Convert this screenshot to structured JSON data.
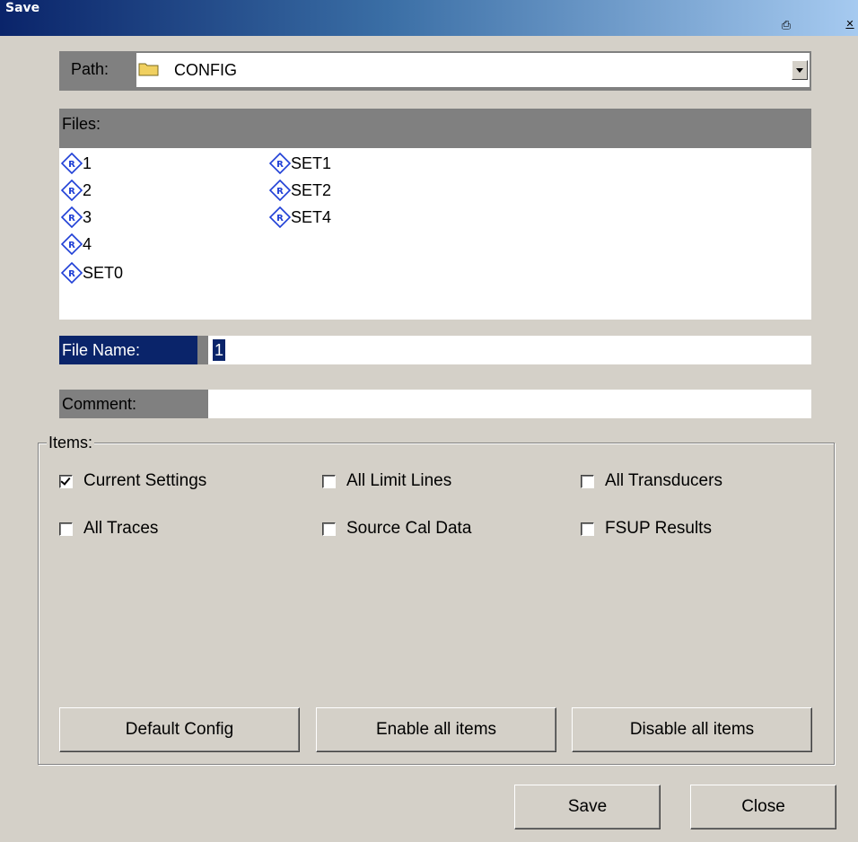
{
  "window": {
    "title": "Save"
  },
  "path": {
    "label": "Path:",
    "value": "CONFIG"
  },
  "files": {
    "label": "Files:",
    "items": [
      "1",
      "2",
      "3",
      "4",
      "SET0",
      "SET1",
      "SET2",
      "SET4"
    ]
  },
  "file_name": {
    "label": "File Name:",
    "value": "1"
  },
  "comment": {
    "label": "Comment:",
    "value": ""
  },
  "items": {
    "label": "Items:",
    "checkboxes": [
      {
        "label": "Current Settings",
        "checked": true
      },
      {
        "label": "All Limit Lines",
        "checked": false
      },
      {
        "label": "All Transducers",
        "checked": false
      },
      {
        "label": "All Traces",
        "checked": false
      },
      {
        "label": "Source Cal Data",
        "checked": false
      },
      {
        "label": "FSUP Results",
        "checked": false
      }
    ],
    "buttons": {
      "default_config": "Default Config",
      "enable_all": "Enable all items",
      "disable_all": "Disable all items"
    }
  },
  "actions": {
    "save": "Save",
    "close": "Close"
  },
  "colors": {
    "title_bar": "#0a246a",
    "selection": "#0a246a",
    "header_gray": "#808080",
    "dialog_bg": "#d4d0c8"
  }
}
